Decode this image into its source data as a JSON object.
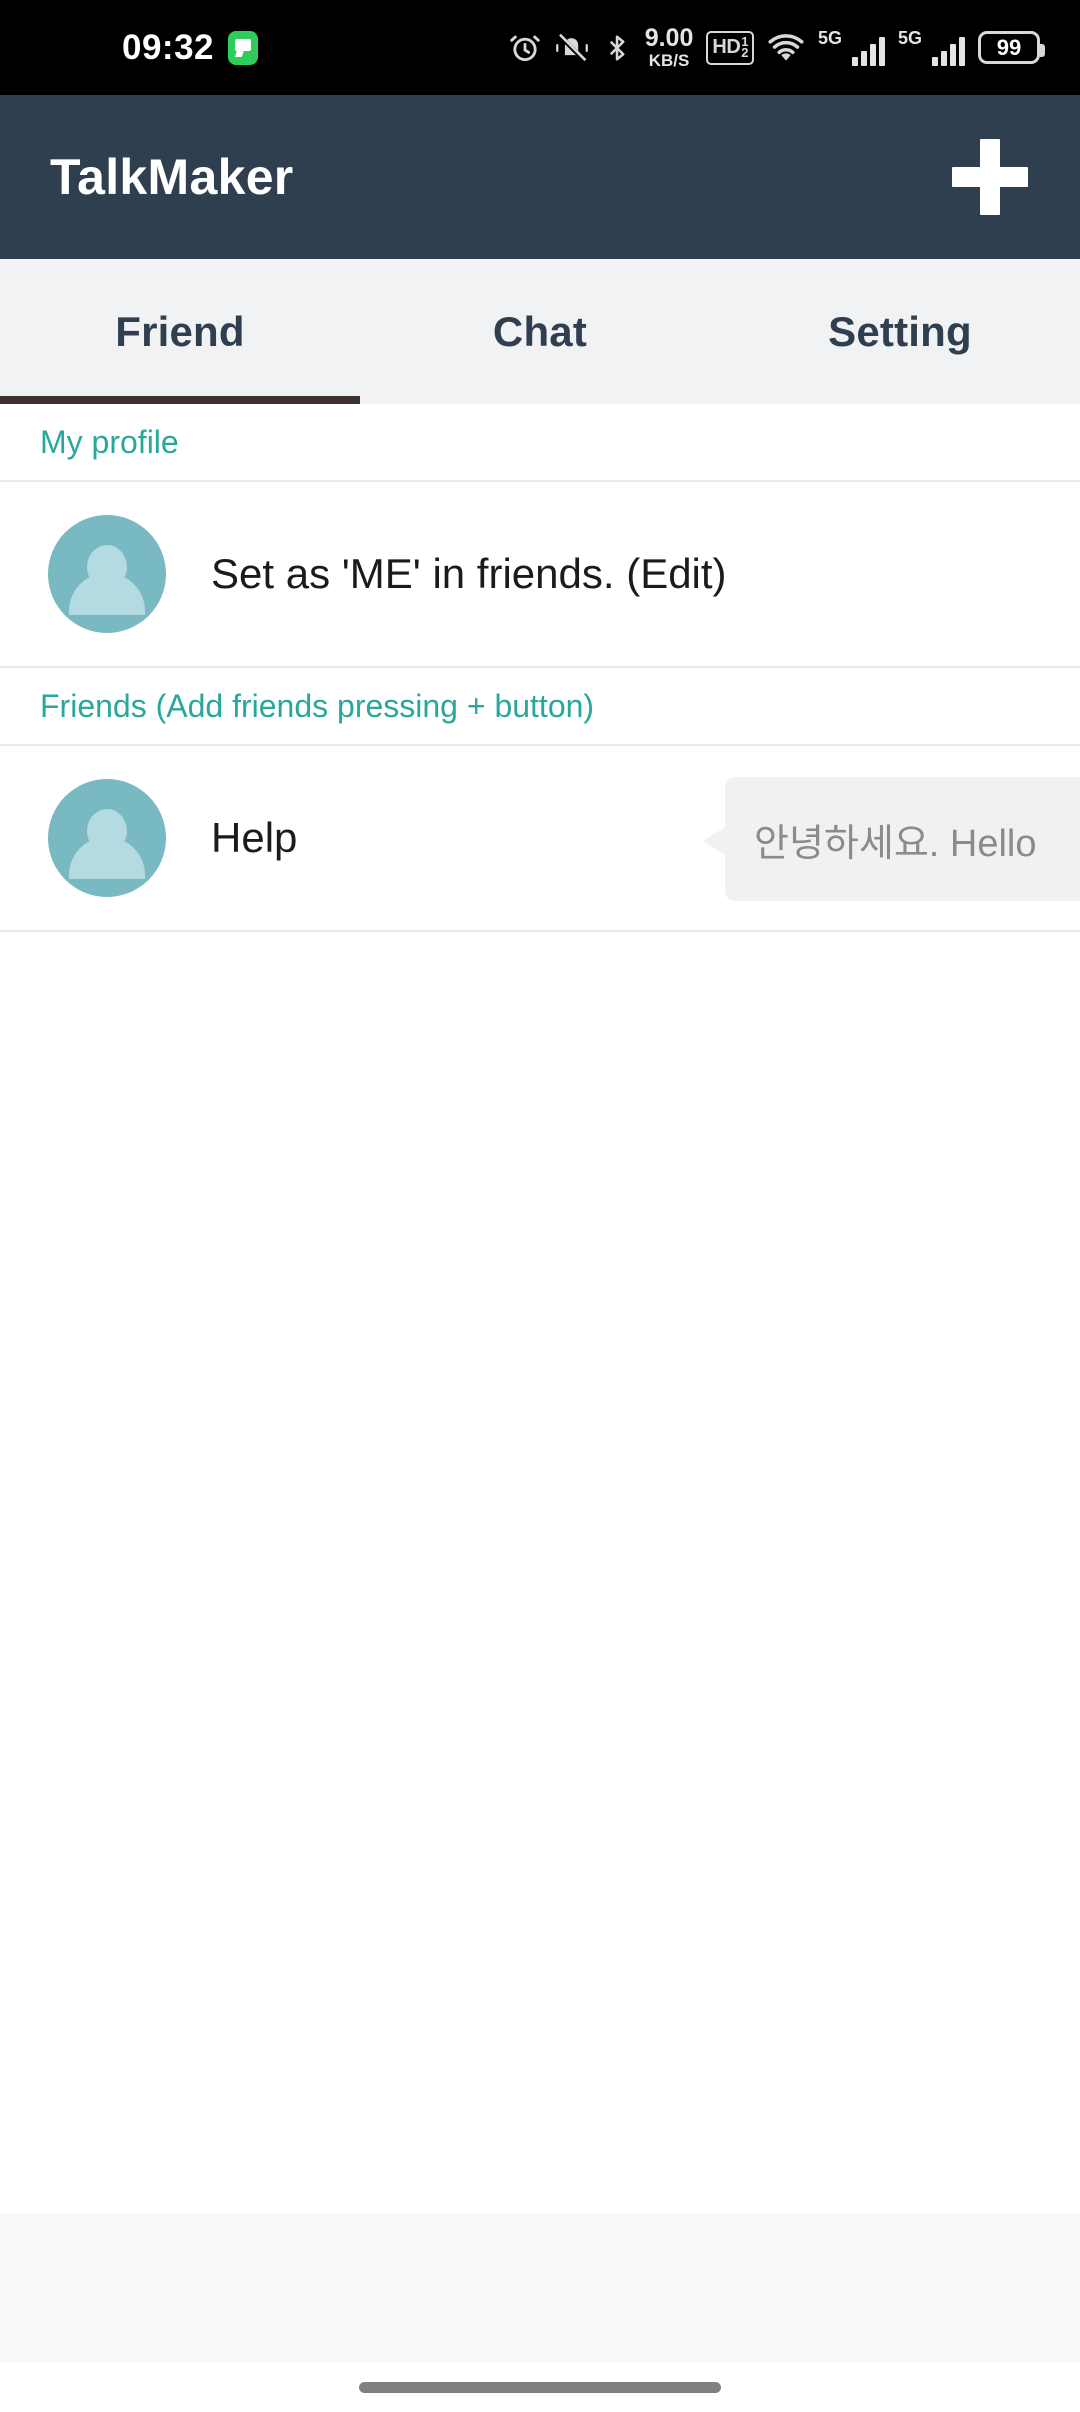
{
  "status_bar": {
    "time": "09:32",
    "message_icon": "message-icon",
    "alarm_icon": "alarm-icon",
    "mute_icon": "mute-bell-icon",
    "bluetooth_icon": "bluetooth-icon",
    "network_speed_value": "9.00",
    "network_speed_unit": "KB/S",
    "hd_label": "HD",
    "hd_sup": "1",
    "hd_sub": "2",
    "wifi_icon": "wifi-icon",
    "sim1_network": "5G",
    "sim2_network": "5G",
    "battery_level": "99"
  },
  "app_bar": {
    "title": "TalkMaker",
    "add_button_label": "+",
    "background_color": "#2f3f50"
  },
  "tabs": {
    "items": [
      {
        "label": "Friend",
        "active": true
      },
      {
        "label": "Chat",
        "active": false
      },
      {
        "label": "Setting",
        "active": false
      }
    ],
    "active_indicator_color": "#3e302e",
    "tab_text_color": "#2f3f50",
    "background_color": "#f1f2f4"
  },
  "sections": {
    "my_profile": {
      "header": "My profile",
      "header_color": "#2aa79b",
      "row_label": "Set as 'ME' in friends. (Edit)"
    },
    "friends": {
      "header": "Friends (Add friends pressing + button)",
      "header_color": "#2aa79b",
      "items": [
        {
          "name": "Help",
          "status_message": "안녕하세요. Hello"
        }
      ]
    }
  },
  "avatar": {
    "background_color": "#79b9c2",
    "glyph_color": "#b4dbe1",
    "icon": "person-icon"
  },
  "bottom": {
    "home_indicator": "home-indicator"
  }
}
